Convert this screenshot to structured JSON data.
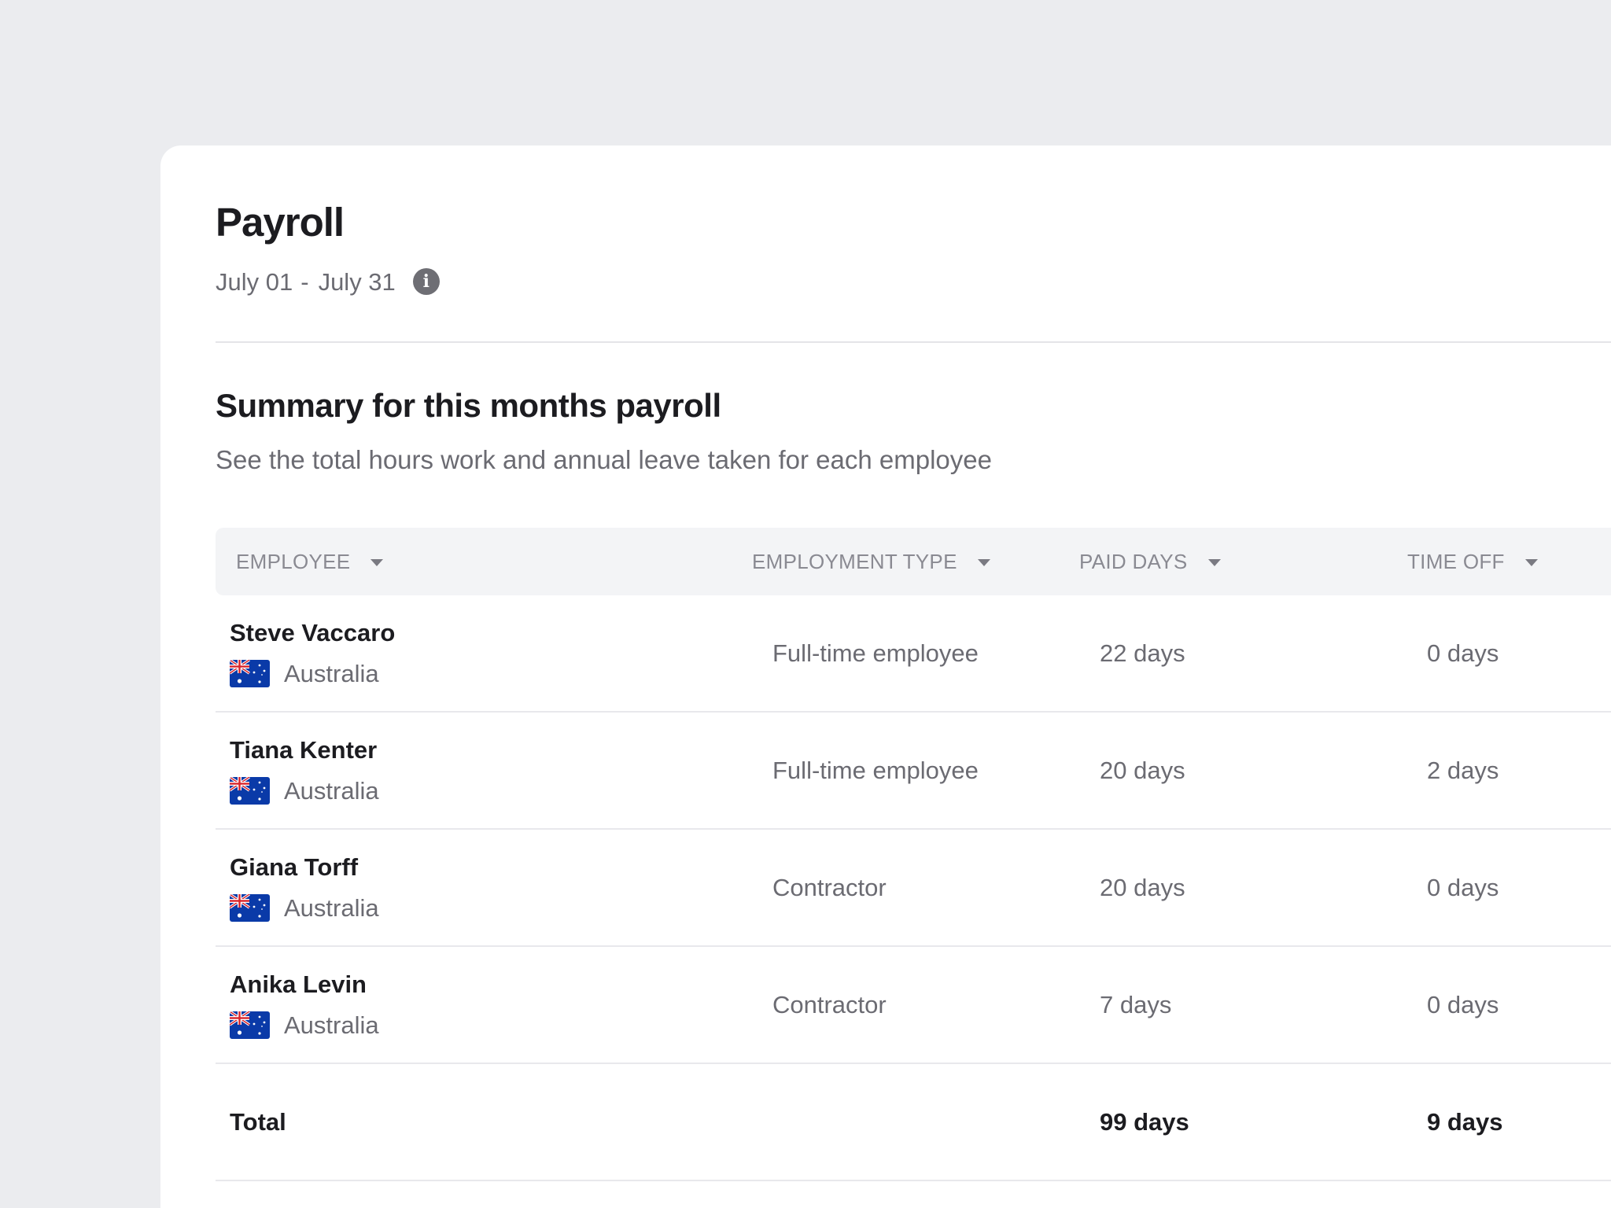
{
  "header": {
    "title": "Payroll",
    "date_start": "July 01",
    "date_separator": "-",
    "date_end": "July 31",
    "info_icon_glyph": "i"
  },
  "summary": {
    "title": "Summary for this months payroll",
    "subtitle": "See the total hours work and annual leave taken for each employee"
  },
  "table": {
    "columns": [
      {
        "label": "EMPLOYEE",
        "icon": "sort-caret-icon"
      },
      {
        "label": "EMPLOYMENT TYPE",
        "icon": "sort-caret-icon"
      },
      {
        "label": "PAID DAYS",
        "icon": "sort-caret-icon"
      },
      {
        "label": "TIME OFF",
        "icon": "sort-caret-icon"
      }
    ],
    "rows": [
      {
        "name": "Steve Vaccaro",
        "country": "Australia",
        "flag_icon": "australia-flag-icon",
        "type": "Full-time employee",
        "paid_days": "22 days",
        "time_off": "0 days"
      },
      {
        "name": "Tiana Kenter",
        "country": "Australia",
        "flag_icon": "australia-flag-icon",
        "type": "Full-time employee",
        "paid_days": "20 days",
        "time_off": "2 days"
      },
      {
        "name": "Giana Torff",
        "country": "Australia",
        "flag_icon": "australia-flag-icon",
        "type": "Contractor",
        "paid_days": "20 days",
        "time_off": "0 days"
      },
      {
        "name": "Anika Levin",
        "country": "Australia",
        "flag_icon": "australia-flag-icon",
        "type": "Contractor",
        "paid_days": "7 days",
        "time_off": "0 days"
      }
    ],
    "total": {
      "label": "Total",
      "paid_days": "99 days",
      "time_off": "9 days"
    }
  },
  "colors": {
    "page_background": "#EBECEF",
    "card_background": "#FFFFFF",
    "header_background": "#F3F4F6",
    "primary_text": "#1C1C20",
    "secondary_text": "#6B6B72",
    "flag_blue": "#0A3AA8"
  }
}
